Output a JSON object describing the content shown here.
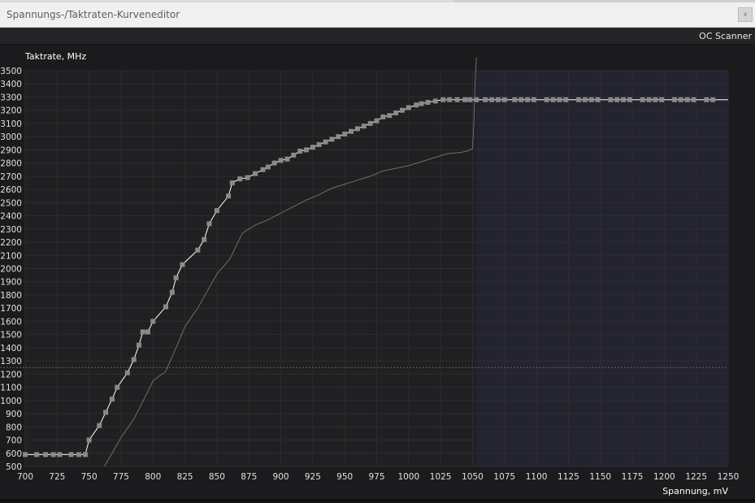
{
  "window": {
    "title": "Spannungs-/Taktraten-Kurveneditor",
    "close_label": "x"
  },
  "toolbar": {
    "oc_scanner_label": "OC Scanner"
  },
  "colors": {
    "background": "#1b1b1d",
    "plot_background": "#202022",
    "locked_region": "#242430",
    "grid": "#2d2d30",
    "curve": "#ffffff",
    "marker": "#8a8a8a",
    "base_curve": "#6e6e6e",
    "axis_text": "#e0e0e0"
  },
  "chart_data": {
    "type": "line",
    "ylabel": "Taktrate, MHz",
    "xlabel": "Spannung, mV",
    "xlim": [
      700,
      1250
    ],
    "ylim": [
      500,
      3500
    ],
    "x_ticks": [
      700,
      725,
      750,
      775,
      800,
      825,
      850,
      875,
      900,
      925,
      950,
      975,
      1000,
      1025,
      1050,
      1075,
      1100,
      1125,
      1150,
      1175,
      1200,
      1225,
      1250
    ],
    "y_ticks": [
      500,
      600,
      700,
      800,
      900,
      1000,
      1100,
      1200,
      1300,
      1400,
      1500,
      1600,
      1700,
      1800,
      1900,
      2000,
      2100,
      2200,
      2300,
      2400,
      2500,
      2600,
      2700,
      2800,
      2900,
      3000,
      3100,
      3200,
      3300,
      3400,
      3500
    ],
    "reference_line_y": 1250,
    "locked_voltage": 1053,
    "grid": true,
    "series": [
      {
        "role": "curve",
        "x": [
          700,
          709,
          716,
          722,
          727,
          736,
          742,
          747,
          750,
          758,
          763,
          768,
          772,
          780,
          785,
          789,
          792,
          796,
          800,
          810,
          815,
          818,
          823,
          835,
          840,
          844,
          850,
          859,
          862,
          868,
          874,
          880,
          886,
          890,
          895,
          900,
          905,
          910,
          915,
          920,
          925,
          930,
          935,
          940,
          945,
          950,
          955,
          960,
          965,
          970,
          975,
          980,
          985,
          990,
          995,
          1000,
          1006,
          1010,
          1015,
          1021,
          1027,
          1032,
          1038,
          1044,
          1048,
          1053,
          1060,
          1065,
          1070,
          1075,
          1083,
          1088,
          1093,
          1098,
          1108,
          1113,
          1118,
          1123,
          1133,
          1138,
          1143,
          1148,
          1158,
          1163,
          1168,
          1173,
          1183,
          1188,
          1193,
          1198,
          1208,
          1213,
          1218,
          1223,
          1233,
          1238,
          1250
        ],
        "y": [
          590,
          590,
          590,
          590,
          590,
          590,
          590,
          590,
          700,
          810,
          910,
          1010,
          1100,
          1210,
          1310,
          1420,
          1520,
          1520,
          1600,
          1710,
          1820,
          1930,
          2030,
          2140,
          2220,
          2340,
          2440,
          2550,
          2650,
          2680,
          2690,
          2720,
          2750,
          2770,
          2800,
          2820,
          2830,
          2860,
          2890,
          2900,
          2920,
          2940,
          2960,
          2980,
          3000,
          3020,
          3040,
          3060,
          3080,
          3100,
          3120,
          3150,
          3160,
          3180,
          3200,
          3220,
          3240,
          3250,
          3260,
          3270,
          3280,
          3280,
          3280,
          3280,
          3280,
          3280,
          3280,
          3280,
          3280,
          3280,
          3280,
          3280,
          3280,
          3280,
          3280,
          3280,
          3280,
          3280,
          3280,
          3280,
          3280,
          3280,
          3280,
          3280,
          3280,
          3280,
          3280,
          3280,
          3280,
          3280,
          3280,
          3280,
          3280,
          3280,
          3280,
          3280,
          3280
        ]
      },
      {
        "role": "base",
        "x": [
          762,
          768,
          775,
          785,
          795,
          800,
          810,
          818,
          825,
          835,
          850,
          860,
          870,
          880,
          890,
          900,
          910,
          920,
          930,
          940,
          950,
          960,
          970,
          980,
          990,
          1000,
          1010,
          1020,
          1030,
          1040,
          1046,
          1050,
          1051,
          1052,
          1053
        ],
        "y": [
          500,
          600,
          720,
          860,
          1050,
          1150,
          1220,
          1400,
          1560,
          1700,
          1960,
          2070,
          2270,
          2330,
          2370,
          2420,
          2470,
          2520,
          2560,
          2610,
          2640,
          2670,
          2700,
          2740,
          2760,
          2780,
          2810,
          2840,
          2870,
          2880,
          2890,
          2910,
          3100,
          3400,
          3600
        ]
      }
    ]
  }
}
